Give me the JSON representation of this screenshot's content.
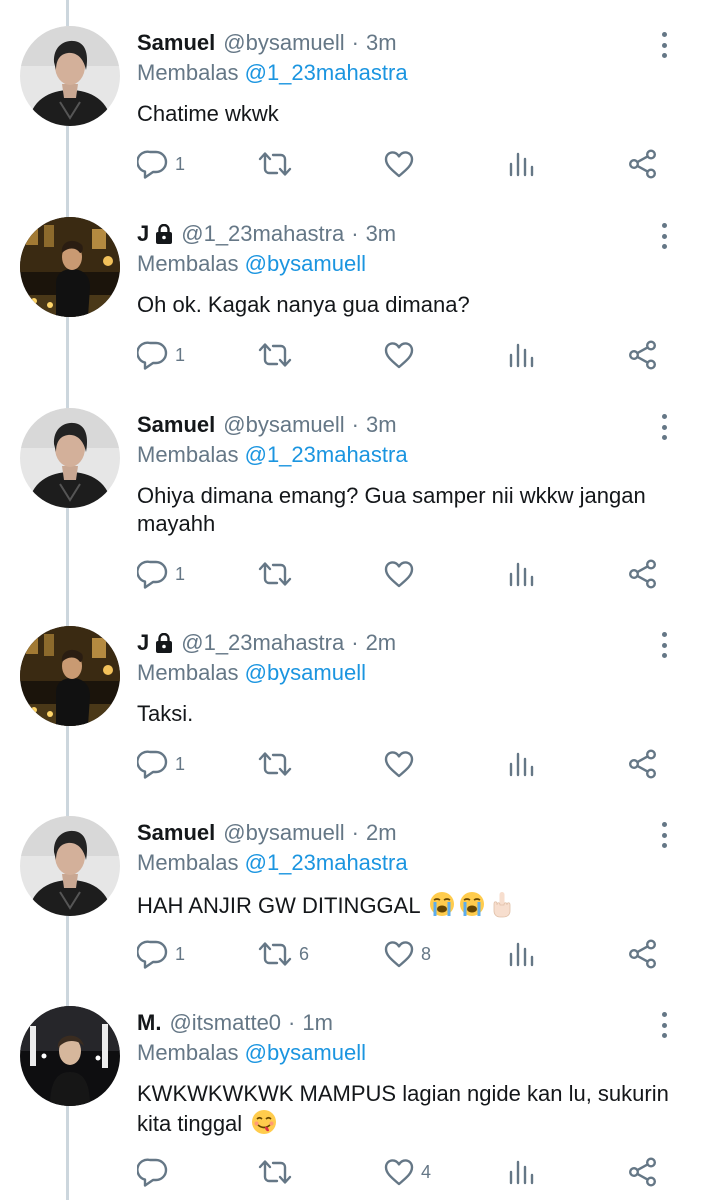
{
  "tweets": [
    {
      "name": "Samuel",
      "handle": "@bysamuell",
      "time": "3m",
      "locked": false,
      "reply_prefix": "Membalas",
      "reply_to": "@1_23mahastra",
      "text": "Chatime wkwk",
      "emoji": [],
      "replies": "1",
      "retweets": "",
      "likes": "",
      "avatar": "samuel"
    },
    {
      "name": "J",
      "handle": "@1_23mahastra",
      "time": "3m",
      "locked": true,
      "reply_prefix": "Membalas",
      "reply_to": "@bysamuell",
      "text": "Oh ok. Kagak nanya gua dimana?",
      "emoji": [],
      "replies": "1",
      "retweets": "",
      "likes": "",
      "avatar": "j"
    },
    {
      "name": "Samuel",
      "handle": "@bysamuell",
      "time": "3m",
      "locked": false,
      "reply_prefix": "Membalas",
      "reply_to": "@1_23mahastra",
      "text": "Ohiya dimana emang? Gua samper nii wkkw jangan mayahh",
      "emoji": [],
      "replies": "1",
      "retweets": "",
      "likes": "",
      "avatar": "samuel"
    },
    {
      "name": "J",
      "handle": "@1_23mahastra",
      "time": "2m",
      "locked": true,
      "reply_prefix": "Membalas",
      "reply_to": "@bysamuell",
      "text": "Taksi.",
      "emoji": [],
      "replies": "1",
      "retweets": "",
      "likes": "",
      "avatar": "j"
    },
    {
      "name": "Samuel",
      "handle": "@bysamuell",
      "time": "2m",
      "locked": false,
      "reply_prefix": "Membalas",
      "reply_to": "@1_23mahastra",
      "text": "HAH ANJIR GW DITINGGAL",
      "emoji": [
        "loudly-crying-face-icon",
        "loudly-crying-face-icon",
        "middle-finger-icon"
      ],
      "replies": "1",
      "retweets": "6",
      "likes": "8",
      "avatar": "samuel"
    },
    {
      "name": "M.",
      "handle": "@itsmatte0",
      "time": "1m",
      "locked": false,
      "reply_prefix": "Membalas",
      "reply_to": "@bysamuell",
      "text": "KWKWKWKWK MAMPUS lagian ngide kan lu, sukurin kita tinggal",
      "emoji": [
        "face-savoring-food-icon"
      ],
      "replies": "",
      "retweets": "",
      "likes": "4",
      "avatar": "m"
    }
  ],
  "separator": "·",
  "colors": {
    "link": "#1b95e0",
    "secondary": "#657786",
    "text": "#14171a",
    "thread_line": "#ccd6dd"
  }
}
